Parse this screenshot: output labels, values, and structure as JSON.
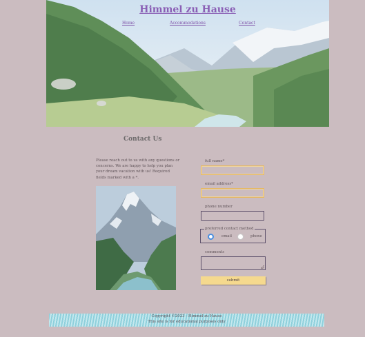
{
  "site": {
    "title": "Himmel zu Hause"
  },
  "nav": {
    "items": [
      "Home",
      "Accommodations",
      "Contact"
    ]
  },
  "contact": {
    "heading": "Contact Us",
    "intro": "Please reach out to us with any questions or concerns. We are happy to help you plan your dream vacation with us! Required fields marked with a *."
  },
  "form": {
    "full_name_label": "full name*",
    "email_label": "email address*",
    "phone_label": "phone number",
    "pref_legend": "preferred contact method",
    "pref_options": [
      "email",
      "phone"
    ],
    "pref_selected": "email",
    "comments_label": "comments",
    "submit_label": "submit"
  },
  "footer": {
    "copyright": "Copyright ©2023 - Himmel zu Hause",
    "note": "This site is for educational purposes only"
  },
  "colors": {
    "page_bg": "#cbbcc0",
    "link": "#7d4fa6",
    "submit_bg": "#f5d98e",
    "focus_border": "#e5b866",
    "radio_selected": "#4a8fe0"
  }
}
